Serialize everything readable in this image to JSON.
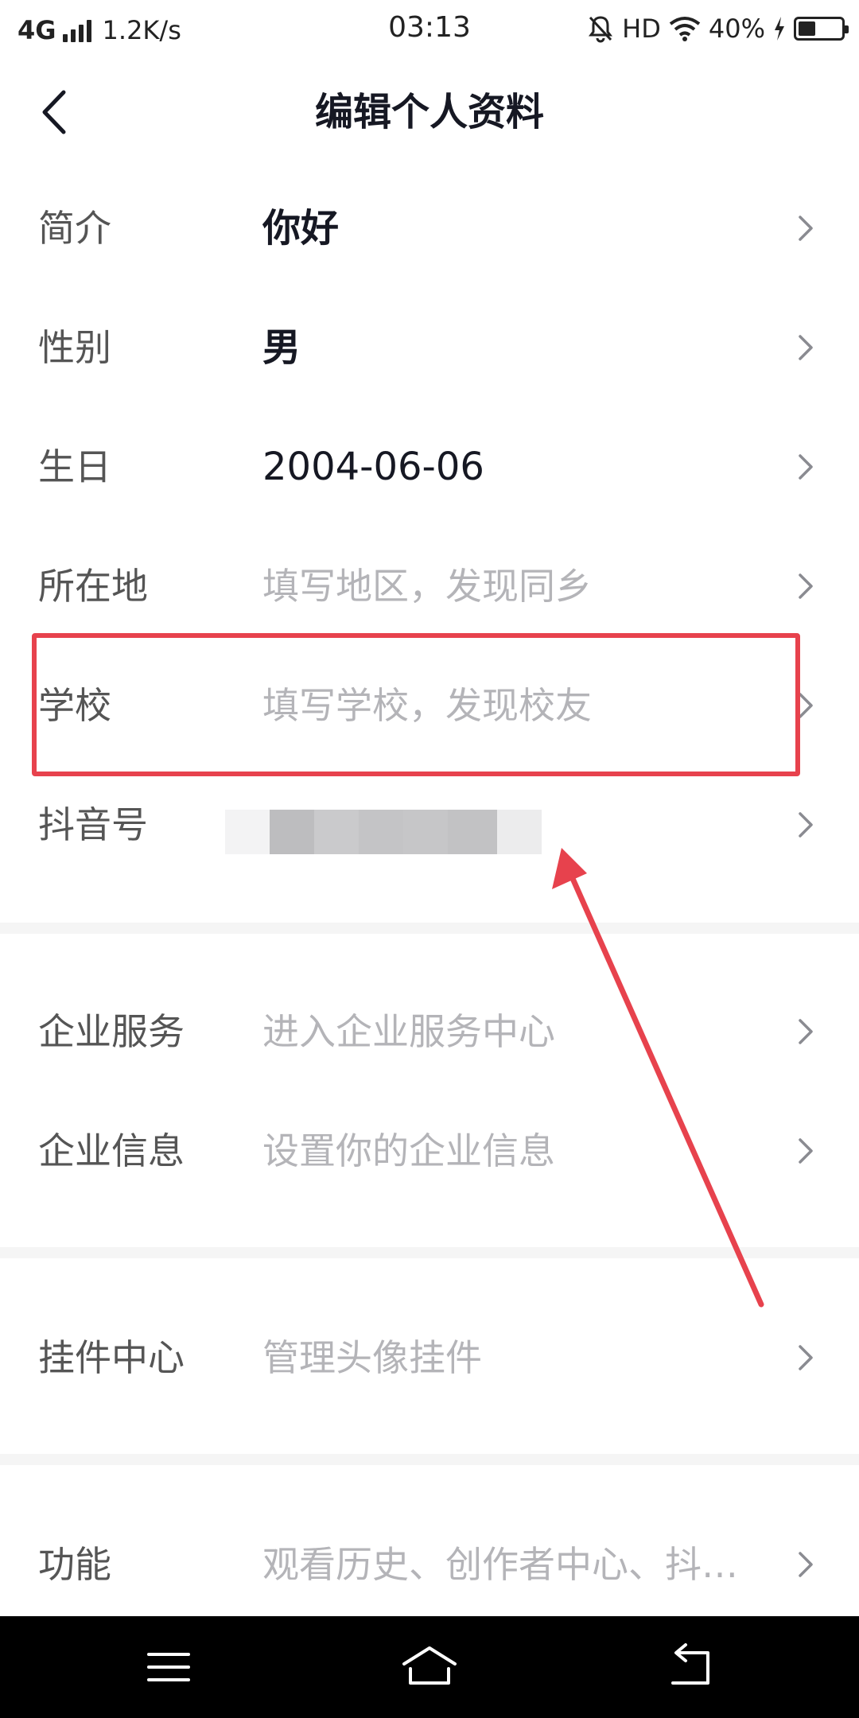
{
  "status_bar": {
    "network": "4G",
    "speed": "1.2K/s",
    "time": "03:13",
    "hd": "HD",
    "battery": "40%",
    "battery_level": 0.4
  },
  "header": {
    "title": "编辑个人资料"
  },
  "rows": [
    {
      "label": "简介",
      "value": "你好"
    },
    {
      "label": "性别",
      "value": "男"
    },
    {
      "label": "生日",
      "value": "2004-06-06"
    },
    {
      "label": "所在地",
      "value": "填写地区，发现同乡"
    },
    {
      "label": "学校",
      "value": "填写学校，发现校友"
    },
    {
      "label": "抖音号",
      "value": ""
    },
    {
      "label": "企业服务",
      "value": "进入企业服务中心"
    },
    {
      "label": "企业信息",
      "value": "设置你的企业信息"
    },
    {
      "label": "挂件中心",
      "value": "管理头像挂件"
    },
    {
      "label": "功能",
      "value": "观看历史、创作者中心、抖…"
    }
  ],
  "colors": {
    "annotation": "#e7424d",
    "placeholder": "#b4b4b8",
    "label": "#555555",
    "text": "#161823"
  },
  "icons": [
    "back-icon",
    "chevron-right-icon",
    "menu-icon",
    "home-icon",
    "return-icon",
    "mute-bell-icon",
    "wifi-icon",
    "battery-icon",
    "charging-icon"
  ]
}
